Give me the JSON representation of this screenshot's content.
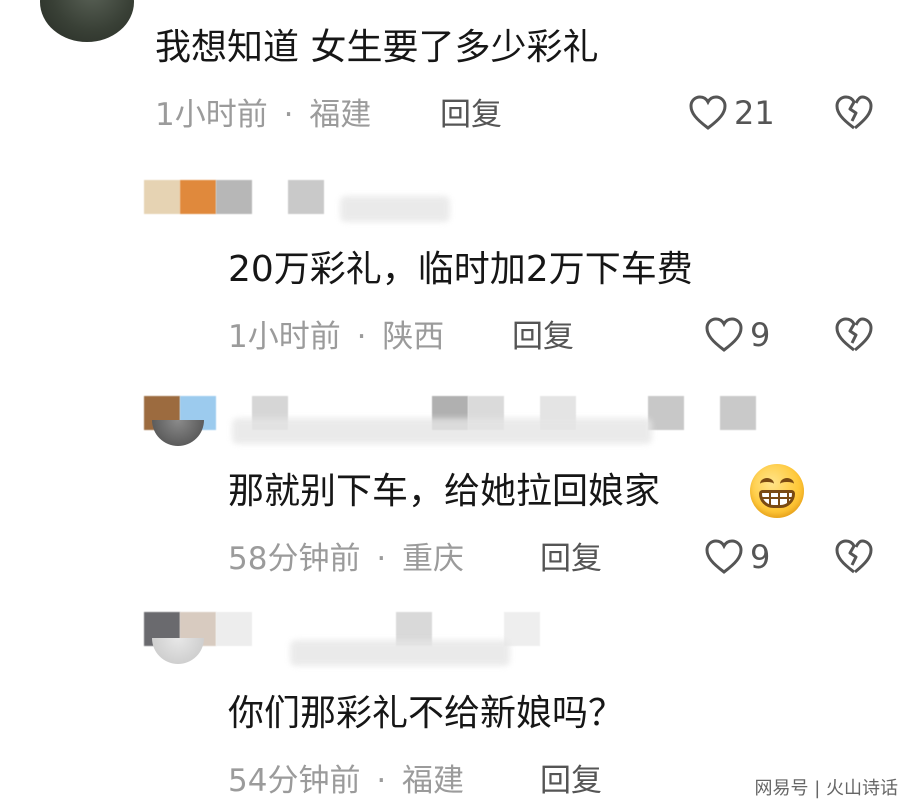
{
  "comments": [
    {
      "text": "我想知道 女生要了多少彩礼",
      "time": "1小时前",
      "location": "福建",
      "reply_label": "回复",
      "likes": "21"
    },
    {
      "text": "20万彩礼，临时加2万下车费",
      "time": "1小时前",
      "location": "陕西",
      "reply_label": "回复",
      "likes": "9"
    },
    {
      "text": "那就别下车，给她拉回娘家",
      "time": "58分钟前",
      "location": "重庆",
      "reply_label": "回复",
      "likes": "9"
    },
    {
      "text": "你们那彩礼不给新娘吗？",
      "time": "54分钟前",
      "location": "福建",
      "reply_label": "回复"
    }
  ],
  "meta_separator": "·",
  "emoji": "grinning-face-emoji",
  "watermark": {
    "text": "网易号 | 火山诗话"
  },
  "icons": {
    "like": "heart-outline-icon",
    "dislike": "broken-heart-icon"
  },
  "colors": {
    "text": "#161616",
    "meta": "#9b9b9b",
    "reply": "#555555",
    "icon": "#555555"
  }
}
